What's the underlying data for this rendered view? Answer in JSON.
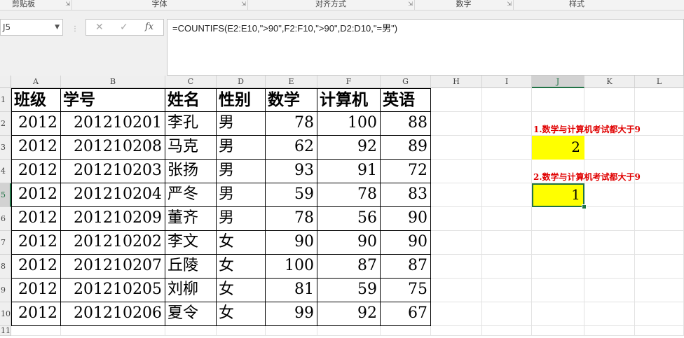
{
  "ribbon": {
    "groups": [
      {
        "label": "剪贴板"
      },
      {
        "label": "字体"
      },
      {
        "label": "对齐方式"
      },
      {
        "label": "数字"
      },
      {
        "label": "样式"
      }
    ]
  },
  "formula_bar": {
    "name_box": "J5",
    "formula": "=COUNTIFS(E2:E10,\">90\",F2:F10,\">90\",D2:D10,\"=男\")",
    "icons": [
      "cancel-icon",
      "enter-icon",
      "function-icon"
    ]
  },
  "columns": [
    "A",
    "B",
    "C",
    "D",
    "E",
    "F",
    "G",
    "H",
    "I",
    "J",
    "K",
    "L"
  ],
  "rows": [
    "1",
    "2",
    "3",
    "4",
    "5",
    "6",
    "7",
    "8",
    "9",
    "10",
    "11"
  ],
  "selected": {
    "column": "J",
    "row": "5"
  },
  "table": {
    "headers": [
      "班级",
      "学号",
      "姓名",
      "性别",
      "数学",
      "计算机",
      "英语"
    ],
    "rows": [
      [
        "2012",
        "201210201",
        "李孔",
        "男",
        "78",
        "100",
        "88"
      ],
      [
        "2012",
        "201210208",
        "马克",
        "男",
        "62",
        "92",
        "89"
      ],
      [
        "2012",
        "201210203",
        "张扬",
        "男",
        "93",
        "91",
        "72"
      ],
      [
        "2012",
        "201210204",
        "严冬",
        "男",
        "59",
        "78",
        "83"
      ],
      [
        "2012",
        "201210209",
        "董齐",
        "男",
        "78",
        "56",
        "90"
      ],
      [
        "2012",
        "201210202",
        "李文",
        "女",
        "90",
        "90",
        "90"
      ],
      [
        "2012",
        "201210207",
        "丘陵",
        "女",
        "100",
        "87",
        "87"
      ],
      [
        "2012",
        "201210205",
        "刘柳",
        "女",
        "81",
        "59",
        "75"
      ],
      [
        "2012",
        "201210206",
        "夏令",
        "女",
        "99",
        "92",
        "67"
      ]
    ]
  },
  "side": {
    "note1": "1.数学与计算机考试都大于9",
    "result1": "2",
    "note2": "2.数学与计算机考试都大于9",
    "result2": "1"
  },
  "colors": {
    "accent": "#217346",
    "highlight": "#ffff00",
    "note_text": "#e00000"
  }
}
